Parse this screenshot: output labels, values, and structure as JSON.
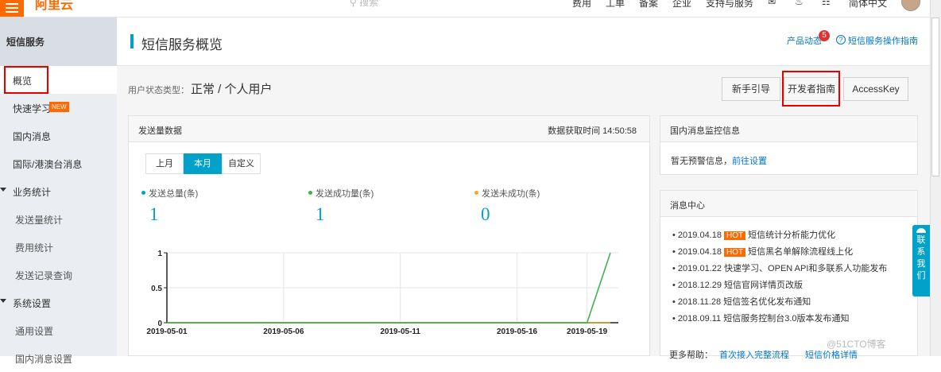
{
  "topbar": {
    "logo": "阿里云",
    "search_placeholder": "搜索",
    "nav": [
      "费用",
      "工单",
      "备案",
      "企业",
      "支持与服务"
    ],
    "language": "简体中文"
  },
  "sidebar": {
    "title": "短信服务",
    "items": [
      {
        "label": "概览"
      },
      {
        "label": "快速学习",
        "badge": "NEW"
      },
      {
        "label": "国内消息"
      },
      {
        "label": "国际/港澳台消息"
      },
      {
        "label": "业务统计"
      },
      {
        "label": "发送量统计"
      },
      {
        "label": "费用统计"
      },
      {
        "label": "发送记录查询"
      },
      {
        "label": "系统设置"
      },
      {
        "label": "通用设置"
      },
      {
        "label": "国内消息设置"
      }
    ]
  },
  "header": {
    "title": "短信服务概览",
    "product_news": "产品动态",
    "news_count": "5",
    "help_glyph": "?",
    "guide": "短信服务操作指南"
  },
  "user_status": {
    "label": "用户状态类型：",
    "value": "正常 / 个人用户"
  },
  "actions": {
    "newbie": "新手引导",
    "dev_guide": "开发者指南",
    "accesskey": "AccessKey"
  },
  "send_panel": {
    "title": "发送量数据",
    "fetch_time": "数据获取时间 14:50:58",
    "tabs": [
      "上月",
      "本月",
      "自定义"
    ],
    "stats": [
      {
        "label": "发送总量(条)",
        "value": "1",
        "color": "#00a2ca"
      },
      {
        "label": "发送成功量(条)",
        "value": "1",
        "color": "#3fb34f"
      },
      {
        "label": "发送未成功(条)",
        "value": "0",
        "color": "#f5a623"
      }
    ]
  },
  "chart_data": {
    "type": "line",
    "categories": [
      "2019-05-01",
      "2019-05-06",
      "2019-05-11",
      "2019-05-16",
      "2019-05-19"
    ],
    "x_ticks": [
      "2019-05-01",
      "2019-05-06",
      "2019-05-11",
      "2019-05-16",
      "2019-05-19"
    ],
    "y_ticks": [
      "0",
      "0.5",
      "1"
    ],
    "ylim": [
      0,
      1
    ],
    "xlim_days": [
      1,
      20
    ],
    "grid": true,
    "series": [
      {
        "values_by_day": [
          [
            1,
            0
          ],
          [
            19,
            0
          ],
          [
            20,
            1
          ]
        ],
        "color": "#3fb34f"
      },
      {
        "values_by_day": [
          [
            1,
            0
          ],
          [
            19,
            0
          ],
          [
            20,
            0
          ]
        ],
        "color": "#d4a017"
      }
    ]
  },
  "monitor_panel": {
    "title": "国内消息监控信息",
    "empty_text": "暂无预警信息，",
    "link": "前往设置"
  },
  "message_panel": {
    "title": "消息中心",
    "items": [
      {
        "date": "2019.04.18",
        "hot": "HOT",
        "text": "短信统计分析能力优化"
      },
      {
        "date": "2019.04.18",
        "hot": "HOT",
        "text": "短信黑名单解除流程线上化"
      },
      {
        "date": "2019.01.22",
        "hot": "",
        "text": "快速学习、OPEN API和多联系人功能发布"
      },
      {
        "date": "2018.12.29",
        "hot": "",
        "text": "短信官网详情页改版"
      },
      {
        "date": "2018.11.28",
        "hot": "",
        "text": "短信签名优化发布通知"
      },
      {
        "date": "2018.09.11",
        "hot": "",
        "text": "短信服务控制台3.0版本发布通知"
      }
    ],
    "more": "更多帮助：",
    "more_links": [
      "首次接入完整流程",
      "短信价格详情"
    ]
  },
  "contact": [
    "联",
    "系",
    "我",
    "们"
  ],
  "watermark": "@51CTO博客"
}
